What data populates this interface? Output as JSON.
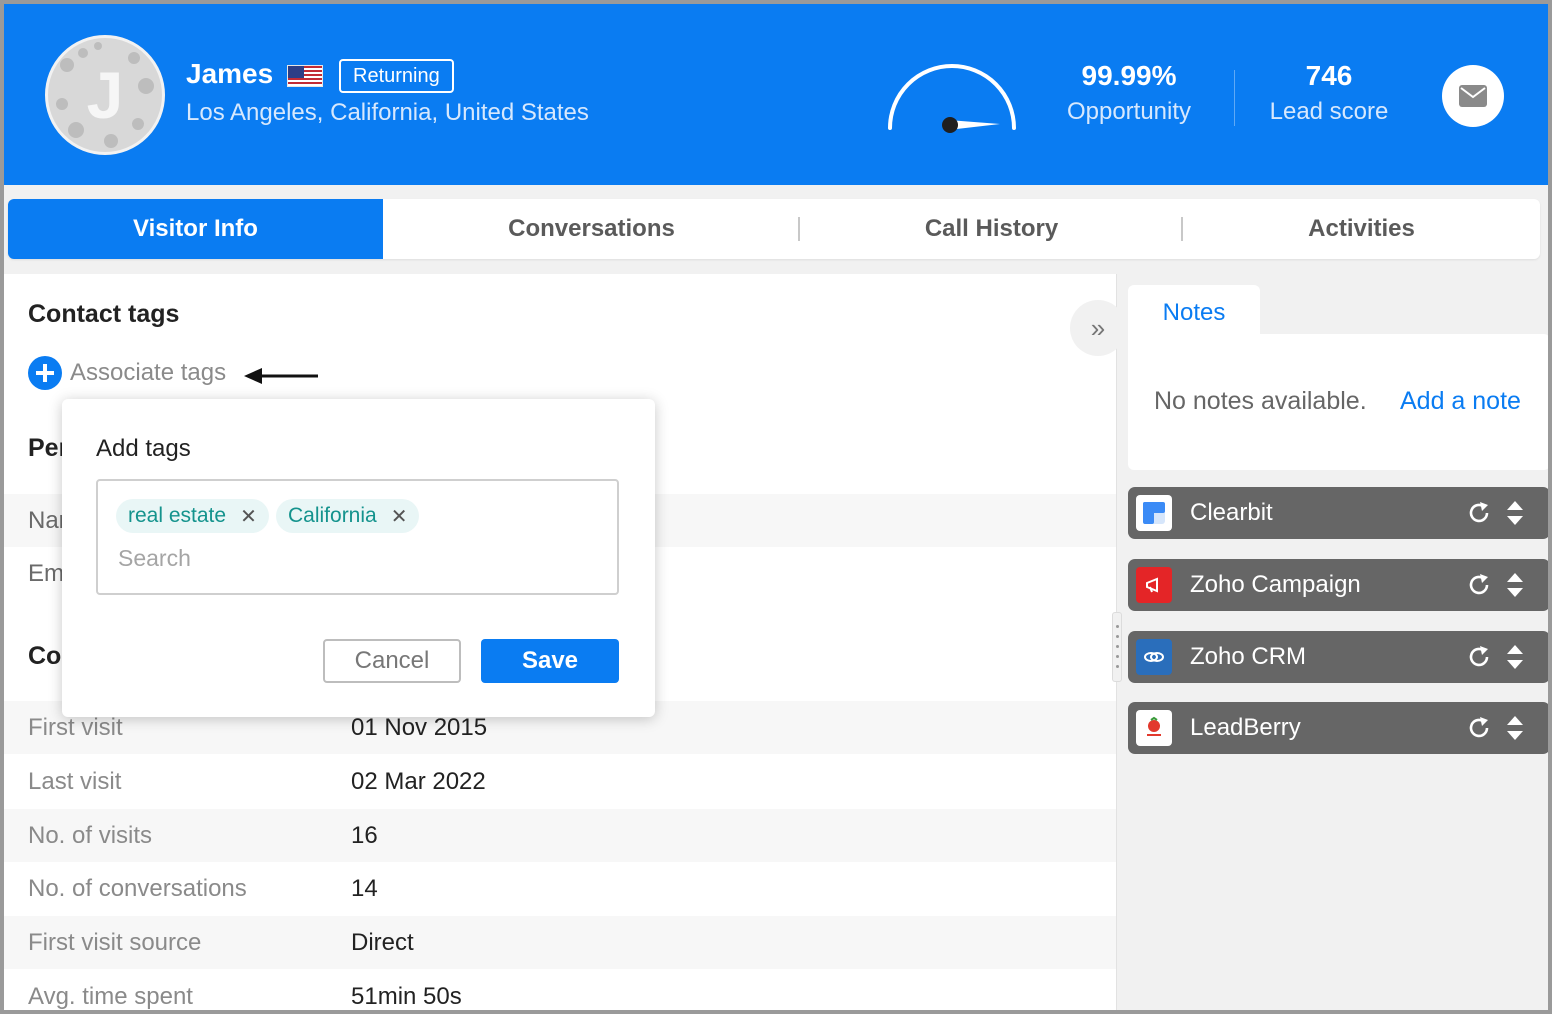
{
  "header": {
    "visitor_name": "James",
    "visitor_initial": "J",
    "status_badge": "Returning",
    "location": "Los Angeles, California, United States",
    "opportunity": {
      "value": "99.99%",
      "label": "Opportunity"
    },
    "lead_score": {
      "value": "746",
      "label": "Lead score"
    },
    "icons": [
      "us-flag-icon",
      "gauge-icon",
      "mail-icon"
    ],
    "accent_color": "#0a7cf2"
  },
  "tabs": [
    {
      "label": "Visitor Info",
      "active": true
    },
    {
      "label": "Conversations",
      "active": false
    },
    {
      "label": "Call History",
      "active": false
    },
    {
      "label": "Activities",
      "active": false
    }
  ],
  "contact_tags": {
    "title": "Contact tags",
    "associate_label": "Associate tags"
  },
  "hidden_sections": {
    "personal_partial": "Per",
    "name_partial": "Nar",
    "email_partial": "Em",
    "contact_partial": "Co"
  },
  "visit_rows": [
    {
      "key": "First visit",
      "value": "01 Nov 2015"
    },
    {
      "key": "Last visit",
      "value": "02 Mar 2022"
    },
    {
      "key": "No. of visits",
      "value": "16"
    },
    {
      "key": "No. of conversations",
      "value": "14"
    },
    {
      "key": "First visit source",
      "value": "Direct"
    },
    {
      "key": "Avg. time spent",
      "value": "51min 50s"
    }
  ],
  "add_tags_popup": {
    "title": "Add tags",
    "tags": [
      "real estate",
      "California"
    ],
    "search_placeholder": "Search",
    "cancel_label": "Cancel",
    "save_label": "Save"
  },
  "notes": {
    "tab_label": "Notes",
    "empty_text": "No notes available.",
    "add_label": "Add a note"
  },
  "integrations": [
    {
      "name": "Clearbit",
      "icon": "clearbit-logo-icon",
      "color": "#3b8bf6"
    },
    {
      "name": "Zoho Campaign",
      "icon": "zoho-campaign-logo-icon",
      "color": "#e42527"
    },
    {
      "name": "Zoho CRM",
      "icon": "zoho-crm-logo-icon",
      "color": "#2a6ebb"
    },
    {
      "name": "LeadBerry",
      "icon": "leadberry-logo-icon",
      "color": "#e2392d"
    }
  ]
}
